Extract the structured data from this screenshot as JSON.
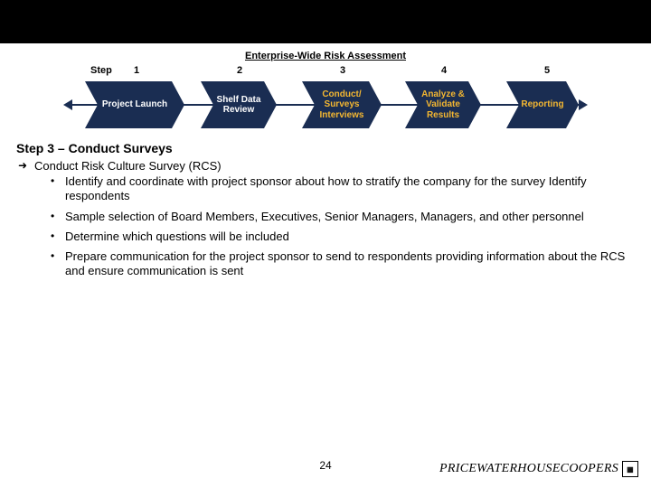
{
  "diagram": {
    "title": "Enterprise-Wide Risk Assessment",
    "step_label": "Step",
    "numbers": [
      "1",
      "2",
      "3",
      "4",
      "5"
    ],
    "boxes": [
      {
        "text": "Project Launch",
        "highlight": false
      },
      {
        "text": "Shelf Data Review",
        "highlight": false
      },
      {
        "text": "Conduct/ Surveys Interviews",
        "highlight": true
      },
      {
        "text": "Analyze & Validate Results",
        "highlight": false
      },
      {
        "text": "Reporting",
        "highlight": false
      }
    ]
  },
  "body": {
    "heading": "Step 3 – Conduct Surveys",
    "l1": [
      {
        "text": "Conduct Risk Culture Survey (RCS)",
        "l2": [
          "Identify and coordinate with project sponsor about how to stratify the company for the survey Identify respondents",
          "Sample selection of Board Members, Executives, Senior Managers, Managers, and other personnel",
          "Determine which questions will be included",
          "Prepare communication for the project sponsor to send to respondents providing information about the RCS and ensure communication is sent"
        ]
      }
    ]
  },
  "pagenum": "24",
  "logo": {
    "text": "PRICEWATERHOUSECOOPERS",
    "sq": "▦"
  },
  "chart_data": {
    "type": "table",
    "title": "Enterprise-Wide Risk Assessment",
    "columns": [
      "Step 1",
      "Step 2",
      "Step 3",
      "Step 4",
      "Step 5"
    ],
    "values": [
      "Project Launch",
      "Shelf Data Review",
      "Conduct/ Surveys Interviews",
      "Analyze & Validate Results",
      "Reporting"
    ],
    "highlighted_index": 2
  }
}
